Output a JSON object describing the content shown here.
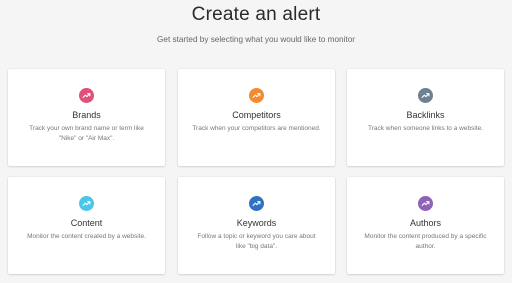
{
  "header": {
    "title": "Create an alert",
    "subtitle": "Get started by selecting what you would like to monitor"
  },
  "cards": [
    {
      "title": "Brands",
      "description": "Track your own brand name or term like \"Nike\" or \"Air Max\".",
      "icon": "trending-up-icon",
      "color": "#e0507a"
    },
    {
      "title": "Competitors",
      "description": "Track when your competitors are mentioned.",
      "icon": "trending-up-icon",
      "color": "#f4892f"
    },
    {
      "title": "Backlinks",
      "description": "Track when someone links to a website.",
      "icon": "trending-up-icon",
      "color": "#6f808f"
    },
    {
      "title": "Content",
      "description": "Monitor the content created by a website.",
      "icon": "trending-up-icon",
      "color": "#4cc6e6"
    },
    {
      "title": "Keywords",
      "description": "Follow a topic or keyword you care about like \"big data\".",
      "icon": "trending-up-icon",
      "color": "#2f72c3"
    },
    {
      "title": "Authors",
      "description": "Monitor the content produced by a specific author.",
      "icon": "trending-up-icon",
      "color": "#8e63b8"
    }
  ]
}
